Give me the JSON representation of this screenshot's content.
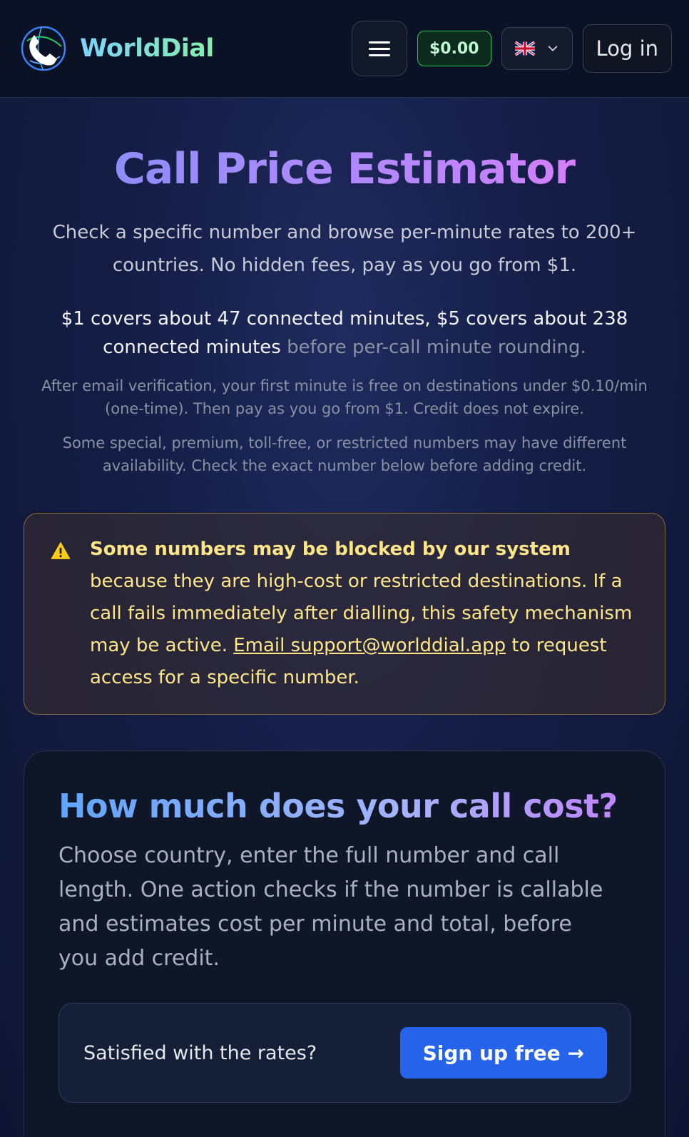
{
  "header": {
    "brand": "WorldDial",
    "balance": "$0.00",
    "language_icon": "uk-flag-icon",
    "login_label": "Log in"
  },
  "hero": {
    "title": "Call Price Estimator",
    "subtitle": "Check a specific number and browse per-minute rates to 200+ countries. No hidden fees, pay as you go from $1.",
    "coverage_main": "$1 covers about 47 connected minutes, $5 covers about 238 connected minutes",
    "coverage_muted": " before per-call minute rounding.",
    "note_free_minute": "After email verification, your first minute is free on destinations under $0.10/min (one-time). Then pay as you go from $1. Credit does not expire.",
    "note_special": "Some special, premium, toll-free, or restricted numbers may have different availability. Check the exact number below before adding credit."
  },
  "warning": {
    "bold": "Some numbers may be blocked by our system",
    "text1": " because they are high-cost or restricted destinations. If a call fails immediately after dialling, this safety mechanism may be active. ",
    "link": "Email support@worlddial.app",
    "text2": " to request access for a specific number."
  },
  "estimator": {
    "title": "How much does your call cost?",
    "description": "Choose country, enter the full number and call length. One action checks if the number is callable and estimates cost per minute and total, before you add credit.",
    "cta_text": "Satisfied with the rates?",
    "cta_button": "Sign up free →"
  },
  "colors": {
    "accent": "#2563eb",
    "balance_green": "#22c55e",
    "warning_text": "#fde68a"
  }
}
